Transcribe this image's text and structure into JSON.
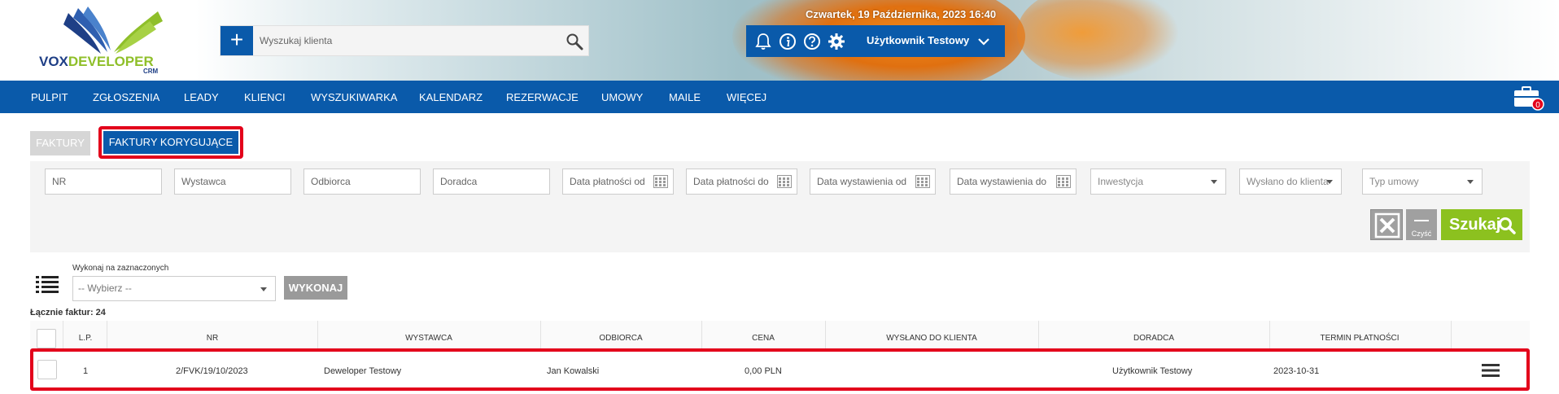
{
  "header": {
    "logo": {
      "word_part1": "VOX",
      "word_part2": "DEVELOPER",
      "sub": "CRM"
    },
    "search": {
      "plus_label": "+",
      "placeholder": "Wyszukaj klienta"
    },
    "datetime": "Czwartek, 19 Października, 2023   16:40",
    "user_name": "Użytkownik Testowy",
    "icons": [
      "bell-icon",
      "info-icon",
      "help-icon",
      "gear-icon",
      "chevron-down-icon"
    ]
  },
  "nav": {
    "items": [
      "PULPIT",
      "ZGŁOSZENIA",
      "LEADY",
      "KLIENCI",
      "WYSZUKIWARKA",
      "KALENDARZ",
      "REZERWACJE",
      "UMOWY",
      "MAILE",
      "WIĘCEJ"
    ],
    "briefcase_count": "0"
  },
  "tabs": {
    "faktury": "FAKTURY",
    "korygujace": "FAKTURY KORYGUJĄCE"
  },
  "filters": {
    "nr": "NR",
    "wystawca": "Wystawca",
    "odbiorca": "Odbiorca",
    "doradca": "Doradca",
    "data_platnosci_od": "Data płatności od",
    "data_platnosci_do": "Data płatności do",
    "data_wystawienia_od": "Data wystawienia od",
    "data_wystawienia_do": "Data wystawienia do",
    "inwestycja": "Inwestycja",
    "wyslano": "Wysłano do klienta",
    "typ_umowy": "Typ umowy",
    "clear_label": "Czyść",
    "search_label": "Szukaj"
  },
  "bulk": {
    "label": "Wykonaj na zaznaczonych",
    "select_value": "-- Wybierz --",
    "execute_label": "WYKONAJ"
  },
  "total": "Łącznie faktur: 24",
  "table": {
    "headers": [
      "L.P.",
      "NR",
      "WYSTAWCA",
      "ODBIORCA",
      "CENA",
      "WYSŁANO DO KLIENTA",
      "DORADCA",
      "TERMIN PŁATNOŚCI"
    ],
    "rows": [
      {
        "lp": "1",
        "nr": "2/FVK/19/10/2023",
        "wystawca": "Deweloper Testowy",
        "odbiorca": "Jan Kowalski",
        "cena": "0,00 PLN",
        "wyslano": "",
        "doradca": "Użytkownik Testowy",
        "termin": "2023-10-31"
      }
    ]
  },
  "colors": {
    "brand_blue": "#0a5aaa",
    "highlight_red": "#e3001b",
    "search_green": "#8cc11f",
    "logo_navy": "#1f3f86",
    "logo_green": "#8fbf2a"
  }
}
